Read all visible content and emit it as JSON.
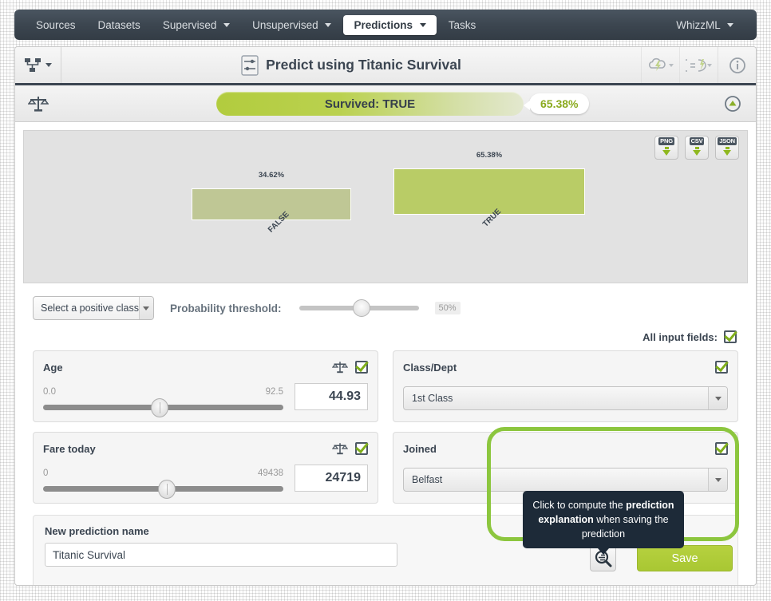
{
  "navbar": {
    "items": [
      {
        "label": "Sources",
        "has_caret": false,
        "active": false
      },
      {
        "label": "Datasets",
        "has_caret": false,
        "active": false
      },
      {
        "label": "Supervised",
        "has_caret": true,
        "active": false
      },
      {
        "label": "Unsupervised",
        "has_caret": true,
        "active": false
      },
      {
        "label": "Predictions",
        "has_caret": true,
        "active": true
      },
      {
        "label": "Tasks",
        "has_caret": false,
        "active": false
      }
    ],
    "right_item": {
      "label": "WhizzML",
      "has_caret": true
    }
  },
  "titlebar": {
    "title": "Predict using Titanic Survival",
    "left_icon": "model-tree-icon",
    "center_icon": "prediction-sliders-icon",
    "right_icons": [
      "lightning-cloud-icon",
      "batch-prediction-icon",
      "info-icon"
    ]
  },
  "result": {
    "scale_icon": "balance-scale-icon",
    "label": "Survived: TRUE",
    "percentage": "65.38%",
    "collapse_icon": "collapse-up-icon"
  },
  "chart_data": {
    "type": "bar",
    "title": "",
    "xlabel": "",
    "ylabel": "",
    "categories": [
      "FALSE",
      "TRUE"
    ],
    "values": [
      34.62,
      65.38
    ],
    "value_labels": [
      "34.62%",
      "65.38%"
    ],
    "ylim": [
      0,
      100
    ],
    "grid": false,
    "legend": "none",
    "colors": [
      "#bfc795",
      "#b9cc66"
    ],
    "background": "#e2e2e2"
  },
  "export": {
    "buttons": [
      {
        "label": "PNG",
        "name": "export-png-button"
      },
      {
        "label": "CSV",
        "name": "export-csv-button"
      },
      {
        "label": "JSON",
        "name": "export-json-button"
      }
    ]
  },
  "threshold": {
    "positive_class_value": "Select a positive class",
    "label": "Probability threshold:",
    "value": "50%",
    "slider_percent": 50
  },
  "all_fields": {
    "label": "All input fields:",
    "checked": true
  },
  "fields": [
    {
      "name": "Age",
      "type": "numeric",
      "min": "0.0",
      "max": "92.5",
      "value": "44.93",
      "knob_percent": 48,
      "has_scale_icon": true,
      "checked": true
    },
    {
      "name": "Class/Dept",
      "type": "categorical",
      "value": "1st Class",
      "has_scale_icon": false,
      "checked": true
    },
    {
      "name": "Fare today",
      "type": "numeric",
      "min": "0",
      "max": "49438",
      "value": "24719",
      "knob_percent": 50,
      "has_scale_icon": true,
      "checked": true
    },
    {
      "name": "Joined",
      "type": "categorical",
      "value": "Belfast",
      "has_scale_icon": false,
      "checked": true
    }
  ],
  "bottom": {
    "new_name_label": "New prediction name",
    "new_name_value": "Titanic Survival",
    "new_name_placeholder": "New prediction name",
    "tooltip_text_1": "Click to compute the ",
    "tooltip_bold_1": "prediction explanation",
    "tooltip_text_2": " when saving the prediction",
    "explain_icon": "prediction-explanation-magnifier-icon",
    "save_label": "Save"
  },
  "colors": {
    "accent_green": "#8cc63e",
    "bar_true": "#b9cc66",
    "bar_false": "#bfc795",
    "navbar": "#3c4650",
    "dark_text": "#3b4551",
    "tooltip_bg": "#1d2a38"
  }
}
